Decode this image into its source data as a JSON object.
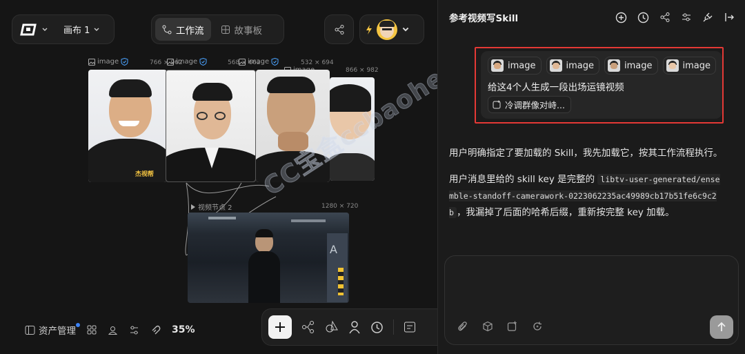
{
  "topbar": {
    "canvas_name": "画布 1",
    "tabs": [
      {
        "label": "工作流",
        "active": true
      },
      {
        "label": "故事板",
        "active": false
      }
    ]
  },
  "nodes": [
    {
      "label": "image",
      "dims": "766 × 962"
    },
    {
      "label": "image",
      "dims": "568 × 662"
    },
    {
      "label": "image",
      "dims": "532 × 694"
    },
    {
      "label": "image",
      "dims": "866 × 982"
    }
  ],
  "video_node": {
    "label": "视频节点 2",
    "dims": "1280 × 720"
  },
  "watermark": "CC宝盒ccbaohe.com",
  "card_caption": "杰视帮",
  "bottom_left": {
    "assets_label": "资产管理",
    "zoom": "35%"
  },
  "panel": {
    "title": "参考视频写Skill",
    "user_message": {
      "chips": [
        "image",
        "image",
        "image",
        "image"
      ],
      "text": "给这4个人生成一段出场运镜视频",
      "skill_chip": "冷调群像对峙..."
    },
    "assistant": {
      "para1": "用户明确指定了要加载的 Skill，我先加载它，按其工作流程执行。",
      "para2_a": "用户消息里给的 skill key 是完整的",
      "para2_code": "libtv-user-generated/ensemble-standoff-camerawork-0223062235ac49989cb17b51fe6c9c2b",
      "para2_b": "，我漏掉了后面的哈希后缀，重新按完整 key 加载。"
    },
    "input": {
      "placeholder": ""
    }
  },
  "colors": {
    "highlight": "#e53935",
    "accent_dot": "#3b82f6",
    "badge": "#f5c542"
  }
}
